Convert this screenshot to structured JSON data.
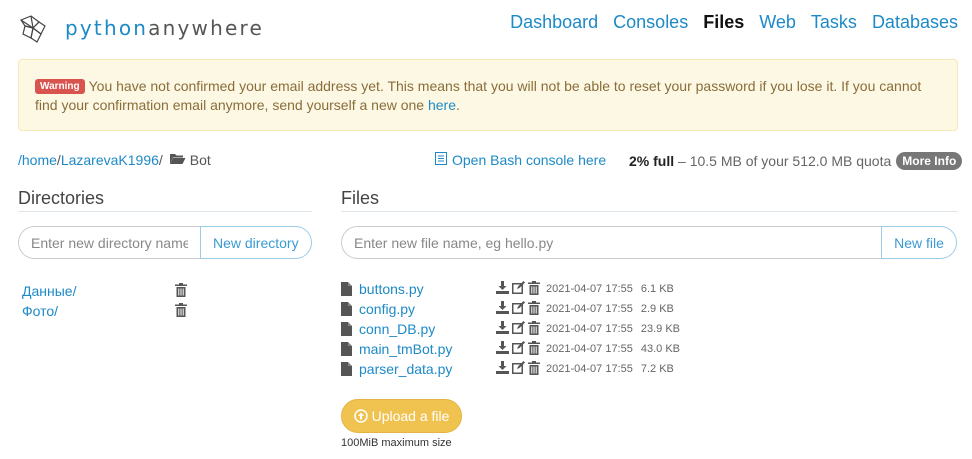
{
  "brand": {
    "prefix": "python",
    "suffix": "anywhere"
  },
  "nav": [
    {
      "label": "Dashboard",
      "active": false
    },
    {
      "label": "Consoles",
      "active": false
    },
    {
      "label": "Files",
      "active": true
    },
    {
      "label": "Web",
      "active": false
    },
    {
      "label": "Tasks",
      "active": false
    },
    {
      "label": "Databases",
      "active": false
    }
  ],
  "warning": {
    "badge": "Warning",
    "text": "You have not confirmed your email address yet. This means that you will not be able to reset your password if you lose it. If you cannot find your confirmation email anymore, send yourself a new one",
    "link": "here",
    "end": "."
  },
  "path": {
    "root": "/home",
    "sep1": "/",
    "user": "LazarevaK1996",
    "sep2": "/",
    "current": "Bot"
  },
  "console_link": "Open Bash console here",
  "quota": {
    "percent": "2% full",
    "dash": " – ",
    "detail": "10.5 MB of your 512.0 MB quota",
    "more_info": "More Info"
  },
  "directories": {
    "title": "Directories",
    "placeholder": "Enter new directory name",
    "button": "New directory",
    "items": [
      {
        "name": "Данные/"
      },
      {
        "name": "Фото/"
      }
    ]
  },
  "files": {
    "title": "Files",
    "placeholder": "Enter new file name, eg hello.py",
    "button": "New file",
    "items": [
      {
        "name": "buttons.py",
        "date": "2021-04-07 17:55",
        "size": "6.1 KB"
      },
      {
        "name": "config.py",
        "date": "2021-04-07 17:55",
        "size": "2.9 KB"
      },
      {
        "name": "conn_DB.py",
        "date": "2021-04-07 17:55",
        "size": "23.9 KB"
      },
      {
        "name": "main_tmBot.py",
        "date": "2021-04-07 17:55",
        "size": "43.0 KB"
      },
      {
        "name": "parser_data.py",
        "date": "2021-04-07 17:55",
        "size": "7.2 KB"
      }
    ],
    "upload_label": "Upload a file",
    "upload_note": "100MiB maximum size"
  },
  "colors": {
    "link": "#1d8ac7",
    "warning_bg": "#fcf8e3",
    "upload": "#f0c24f",
    "badge": "#d9534f"
  }
}
